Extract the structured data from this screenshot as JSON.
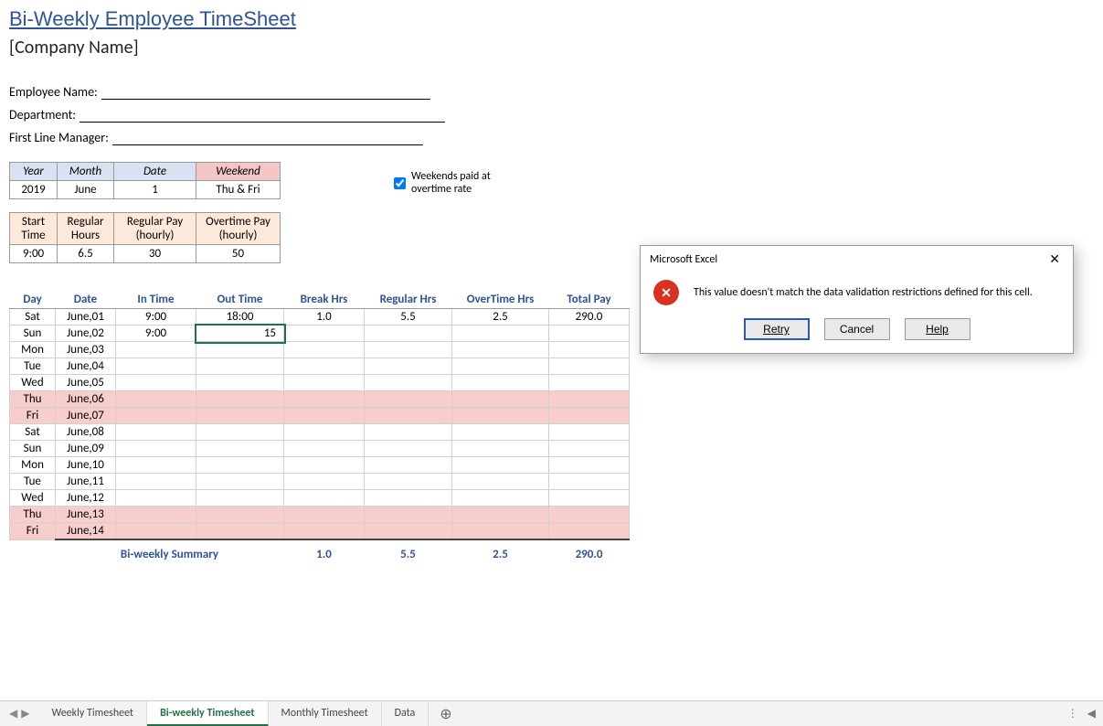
{
  "title": "Bi-Weekly Employee TimeSheet",
  "company": "[Company Name]",
  "info": {
    "employee_label": "Employee Name:",
    "department_label": "Department:",
    "manager_label": "First Line Manager:"
  },
  "setup1": {
    "headers": {
      "year": "Year",
      "month": "Month",
      "date": "Date",
      "weekend": "Weekend"
    },
    "values": {
      "year": "2019",
      "month": "June",
      "date": "1",
      "weekend": "Thu & Fri"
    }
  },
  "setup2": {
    "headers": {
      "start": "Start Time",
      "reg": "Regular Hours",
      "rpay": "Regular Pay (hourly)",
      "opay": "Overtime Pay (hourly)"
    },
    "values": {
      "start": "9:00",
      "reg": "6.5",
      "rpay": "30",
      "opay": "50"
    }
  },
  "checkbox": {
    "label": "Weekends paid at overtime rate",
    "checked": true
  },
  "columns": {
    "day": "Day",
    "date": "Date",
    "in": "In Time",
    "out": "Out Time",
    "break": "Break Hrs",
    "reg": "Regular Hrs",
    "ot": "OverTime Hrs",
    "pay": "Total Pay"
  },
  "rows": [
    {
      "day": "Sat",
      "date": "June,01",
      "in": "9:00",
      "out": "18:00",
      "break": "1.0",
      "reg": "5.5",
      "ot": "2.5",
      "pay": "290.0",
      "weekend": false
    },
    {
      "day": "Sun",
      "date": "June,02",
      "in": "9:00",
      "out": "15",
      "break": "",
      "reg": "",
      "ot": "",
      "pay": "",
      "weekend": false,
      "active": true
    },
    {
      "day": "Mon",
      "date": "June,03",
      "in": "",
      "out": "",
      "break": "",
      "reg": "",
      "ot": "",
      "pay": "",
      "weekend": false
    },
    {
      "day": "Tue",
      "date": "June,04",
      "in": "",
      "out": "",
      "break": "",
      "reg": "",
      "ot": "",
      "pay": "",
      "weekend": false
    },
    {
      "day": "Wed",
      "date": "June,05",
      "in": "",
      "out": "",
      "break": "",
      "reg": "",
      "ot": "",
      "pay": "",
      "weekend": false
    },
    {
      "day": "Thu",
      "date": "June,06",
      "in": "",
      "out": "",
      "break": "",
      "reg": "",
      "ot": "",
      "pay": "",
      "weekend": true
    },
    {
      "day": "Fri",
      "date": "June,07",
      "in": "",
      "out": "",
      "break": "",
      "reg": "",
      "ot": "",
      "pay": "",
      "weekend": true
    },
    {
      "day": "Sat",
      "date": "June,08",
      "in": "",
      "out": "",
      "break": "",
      "reg": "",
      "ot": "",
      "pay": "",
      "weekend": false
    },
    {
      "day": "Sun",
      "date": "June,09",
      "in": "",
      "out": "",
      "break": "",
      "reg": "",
      "ot": "",
      "pay": "",
      "weekend": false
    },
    {
      "day": "Mon",
      "date": "June,10",
      "in": "",
      "out": "",
      "break": "",
      "reg": "",
      "ot": "",
      "pay": "",
      "weekend": false
    },
    {
      "day": "Tue",
      "date": "June,11",
      "in": "",
      "out": "",
      "break": "",
      "reg": "",
      "ot": "",
      "pay": "",
      "weekend": false
    },
    {
      "day": "Wed",
      "date": "June,12",
      "in": "",
      "out": "",
      "break": "",
      "reg": "",
      "ot": "",
      "pay": "",
      "weekend": false
    },
    {
      "day": "Thu",
      "date": "June,13",
      "in": "",
      "out": "",
      "break": "",
      "reg": "",
      "ot": "",
      "pay": "",
      "weekend": true
    },
    {
      "day": "Fri",
      "date": "June,14",
      "in": "",
      "out": "",
      "break": "",
      "reg": "",
      "ot": "",
      "pay": "",
      "weekend": true
    }
  ],
  "summary": {
    "label": "Bi-weekly Summary",
    "break": "1.0",
    "reg": "5.5",
    "ot": "2.5",
    "pay": "290.0"
  },
  "tabs": {
    "items": [
      "Weekly Timesheet",
      "Bi-weekly Timesheet",
      "Monthly Timesheet",
      "Data"
    ],
    "active": 1
  },
  "dialog": {
    "title": "Microsoft Excel",
    "message": "This value doesn't match the data validation restrictions defined for this cell.",
    "buttons": {
      "retry": "Retry",
      "cancel": "Cancel",
      "help": "Help"
    }
  }
}
